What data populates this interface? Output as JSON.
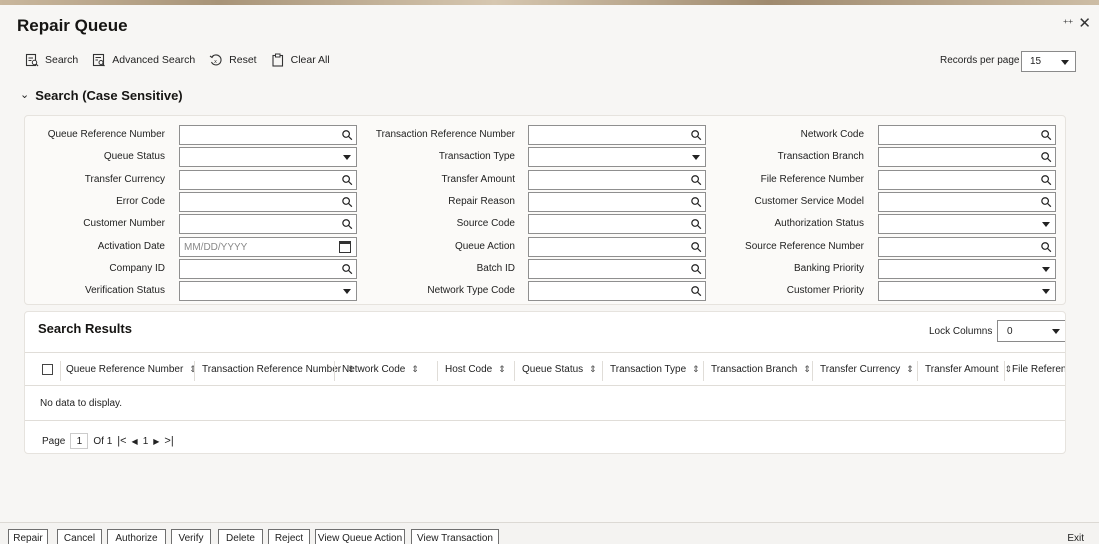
{
  "window": {
    "title": "Repair Queue",
    "shrink_glyph": "⁺⁺",
    "close_glyph": "✕"
  },
  "toolbar": {
    "search": "Search",
    "advanced_search": "Advanced Search",
    "reset": "Reset",
    "clear_all": "Clear All",
    "records_per_page_label": "Records per page",
    "records_per_page_value": "15"
  },
  "search": {
    "header": "Search (Case Sensitive)",
    "col1": [
      {
        "label": "Queue Reference Number",
        "type": "lookup",
        "value": ""
      },
      {
        "label": "Queue Status",
        "type": "select",
        "value": ""
      },
      {
        "label": "Transfer Currency",
        "type": "lookup",
        "value": ""
      },
      {
        "label": "Error Code",
        "type": "lookup",
        "value": ""
      },
      {
        "label": "Customer Number",
        "type": "lookup",
        "value": ""
      },
      {
        "label": "Activation Date",
        "type": "date",
        "value": "",
        "placeholder": "MM/DD/YYYY"
      },
      {
        "label": "Company ID",
        "type": "lookup",
        "value": ""
      },
      {
        "label": "Verification Status",
        "type": "select",
        "value": ""
      }
    ],
    "col2": [
      {
        "label": "Transaction Reference Number",
        "type": "lookup",
        "value": ""
      },
      {
        "label": "Transaction Type",
        "type": "select",
        "value": ""
      },
      {
        "label": "Transfer Amount",
        "type": "lookup",
        "value": ""
      },
      {
        "label": "Repair Reason",
        "type": "lookup",
        "value": ""
      },
      {
        "label": "Source Code",
        "type": "lookup",
        "value": ""
      },
      {
        "label": "Queue Action",
        "type": "lookup",
        "value": ""
      },
      {
        "label": "Batch ID",
        "type": "lookup",
        "value": ""
      },
      {
        "label": "Network Type Code",
        "type": "lookup",
        "value": ""
      }
    ],
    "col3": [
      {
        "label": "Network Code",
        "type": "lookup",
        "value": ""
      },
      {
        "label": "Transaction Branch",
        "type": "lookup",
        "value": ""
      },
      {
        "label": "File Reference Number",
        "type": "lookup",
        "value": ""
      },
      {
        "label": "Customer Service Model",
        "type": "lookup",
        "value": ""
      },
      {
        "label": "Authorization Status",
        "type": "select",
        "value": ""
      },
      {
        "label": "Source Reference Number",
        "type": "lookup",
        "value": ""
      },
      {
        "label": "Banking Priority",
        "type": "select",
        "value": ""
      },
      {
        "label": "Customer Priority",
        "type": "select",
        "value": ""
      }
    ]
  },
  "results": {
    "title": "Search Results",
    "lock_columns_label": "Lock Columns",
    "lock_columns_value": "0",
    "columns": [
      "Queue Reference Number",
      "Transaction Reference Number",
      "Network Code",
      "Host Code",
      "Queue Status",
      "Transaction Type",
      "Transaction Branch",
      "Transfer Currency",
      "Transfer Amount",
      "File Reference"
    ],
    "no_data": "No data to display.",
    "pager": {
      "page_label": "Page",
      "page_value": "1",
      "of_label": "Of 1",
      "first_glyph": "|<",
      "prev_glyph": "◀",
      "current": "1",
      "next_glyph": "▶",
      "last_glyph": ">|"
    }
  },
  "bottom_buttons": [
    "Repair",
    "Cancel",
    "Authorize",
    "Verify",
    "Delete",
    "Reject",
    "View Queue Action",
    "View Transaction"
  ],
  "exit_label": "Exit"
}
